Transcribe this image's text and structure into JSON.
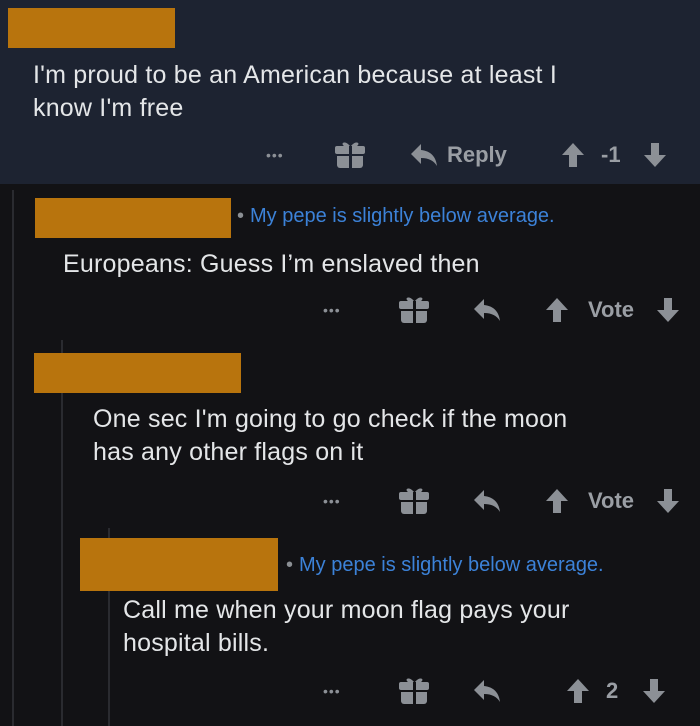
{
  "comments": [
    {
      "text_lines": [
        "I'm proud to be an American because at least I",
        "know I'm free"
      ],
      "actions": {
        "more": "•••",
        "reply": "Reply",
        "score": "-1"
      }
    },
    {
      "flair": "My pepe is slightly below average.",
      "text_lines": [
        "Europeans: Guess I’m enslaved then"
      ],
      "actions": {
        "more": "•••",
        "score": "Vote"
      }
    },
    {
      "text_lines": [
        "One sec I'm going to go check if the moon",
        "has any other flags on it"
      ],
      "actions": {
        "more": "•••",
        "score": "Vote"
      }
    },
    {
      "flair": "My pepe is slightly below average.",
      "text_lines": [
        "Call me when your moon flag pays your",
        "hospital bills."
      ],
      "actions": {
        "more": "•••",
        "score": "2"
      }
    }
  ],
  "icons": [
    "more-icon",
    "gift-icon",
    "reply-icon",
    "upvote-icon",
    "downvote-icon"
  ],
  "colors": {
    "background": "#121215",
    "top_comment_bg": "#1d2331",
    "redaction": "#b8740d",
    "flair": "#3c82d8",
    "text": "#e4e6e8",
    "action": "#8c9096"
  }
}
